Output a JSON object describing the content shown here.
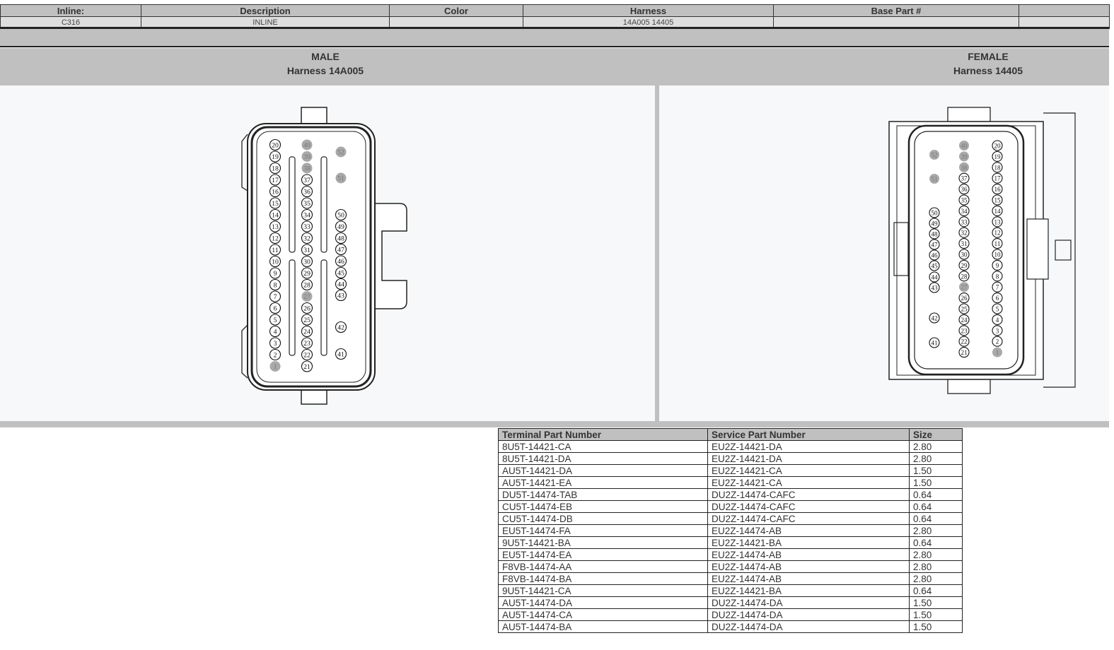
{
  "header": {
    "columns": [
      "Inline:",
      "Description",
      "Color",
      "Harness",
      "Base Part #",
      ""
    ],
    "values": [
      "C316",
      "INLINE",
      "",
      "14A005 14405",
      "",
      ""
    ]
  },
  "male": {
    "title": "MALE",
    "harness": "Harness 14A005"
  },
  "female": {
    "title": "FEMALE",
    "harness": "Harness 14405"
  },
  "connector": {
    "pin_columns": {
      "outer": [
        20,
        19,
        18,
        17,
        16,
        15,
        14,
        13,
        12,
        11,
        10,
        9,
        8,
        7,
        6,
        5,
        4,
        3,
        2,
        1
      ],
      "middle": [
        40,
        39,
        38,
        37,
        36,
        35,
        34,
        33,
        32,
        31,
        30,
        29,
        28,
        27,
        26,
        25,
        24,
        23,
        22,
        21
      ],
      "side": [
        52,
        51,
        50,
        49,
        48,
        47,
        46,
        45,
        44,
        43,
        42,
        41
      ]
    },
    "unused_pins": [
      1,
      27,
      38,
      39,
      40,
      51,
      52
    ],
    "unused_pin_color": "#a9a9a9"
  },
  "parts_table": {
    "headers": [
      "Terminal Part Number",
      "Service Part Number",
      "Size"
    ],
    "rows": [
      [
        "8U5T-14421-CA",
        "EU2Z-14421-DA",
        "2.80"
      ],
      [
        "8U5T-14421-DA",
        "EU2Z-14421-DA",
        "2.80"
      ],
      [
        "AU5T-14421-DA",
        "EU2Z-14421-CA",
        "1.50"
      ],
      [
        "AU5T-14421-EA",
        "EU2Z-14421-CA",
        "1.50"
      ],
      [
        "DU5T-14474-TAB",
        "DU2Z-14474-CAFC",
        "0.64"
      ],
      [
        "CU5T-14474-EB",
        "DU2Z-14474-CAFC",
        "0.64"
      ],
      [
        "CU5T-14474-DB",
        "DU2Z-14474-CAFC",
        "0.64"
      ],
      [
        "EU5T-14474-FA",
        "EU2Z-14474-AB",
        "2.80"
      ],
      [
        "9U5T-14421-BA",
        "EU2Z-14421-BA",
        "0.64"
      ],
      [
        "EU5T-14474-EA",
        "EU2Z-14474-AB",
        "2.80"
      ],
      [
        "F8VB-14474-AA",
        "EU2Z-14474-AB",
        "2.80"
      ],
      [
        "F8VB-14474-BA",
        "EU2Z-14474-AB",
        "2.80"
      ],
      [
        "9U5T-14421-CA",
        "EU2Z-14421-BA",
        "0.64"
      ],
      [
        "AU5T-14474-DA",
        "DU2Z-14474-DA",
        "1.50"
      ],
      [
        "AU5T-14474-CA",
        "DU2Z-14474-DA",
        "1.50"
      ],
      [
        "AU5T-14474-BA",
        "DU2Z-14474-DA",
        "1.50"
      ]
    ]
  }
}
